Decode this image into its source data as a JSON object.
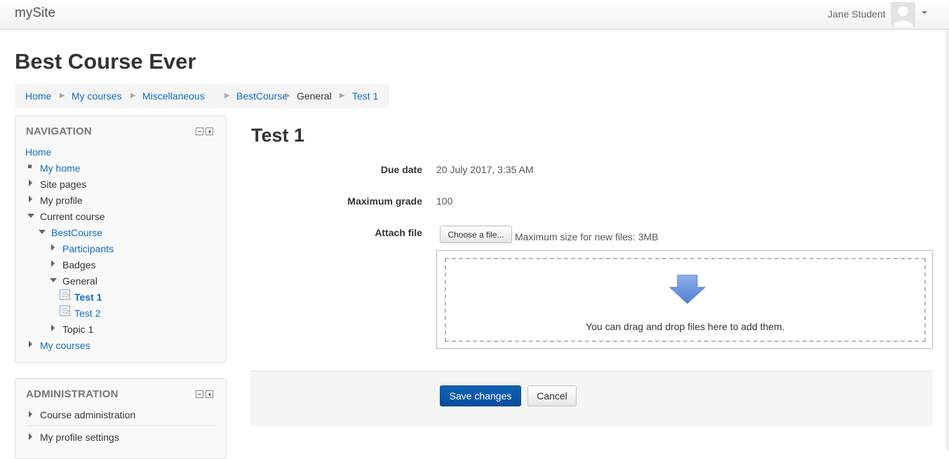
{
  "navbar": {
    "brand": "mySite",
    "user_name": "Jane Student"
  },
  "page": {
    "heading": "Best Course Ever"
  },
  "breadcrumb": [
    {
      "label": "Home",
      "link": true
    },
    {
      "label": "My courses",
      "link": true
    },
    {
      "label": "Miscellaneous",
      "link": true
    },
    {
      "label": "BestCourse",
      "link": true
    },
    {
      "label": "General",
      "link": false
    },
    {
      "label": "Test 1",
      "link": true
    }
  ],
  "navigation": {
    "title": "NAVIGATION",
    "items": [
      {
        "label": "Home",
        "type": "link",
        "icon": "none"
      },
      {
        "label": "My home",
        "type": "link",
        "icon": "bullet-square"
      },
      {
        "label": "Site pages",
        "type": "text",
        "icon": "expand-triangle"
      },
      {
        "label": "My profile",
        "type": "text",
        "icon": "expand-triangle"
      },
      {
        "label": "Current course",
        "type": "text",
        "icon": "collapse-triangle"
      },
      {
        "label": "BestCourse",
        "type": "link",
        "icon": "collapse-triangle"
      },
      {
        "label": "Participants",
        "type": "link",
        "icon": "expand-triangle"
      },
      {
        "label": "Badges",
        "type": "text",
        "icon": "expand-triangle"
      },
      {
        "label": "General",
        "type": "text",
        "icon": "collapse-triangle"
      },
      {
        "label": "Test 1",
        "type": "link-active",
        "icon": "assignment-icon"
      },
      {
        "label": "Test 2",
        "type": "link",
        "icon": "assignment-icon"
      },
      {
        "label": "Topic 1",
        "type": "text",
        "icon": "expand-triangle"
      },
      {
        "label": "My courses",
        "type": "link",
        "icon": "expand-triangle"
      }
    ]
  },
  "administration": {
    "title": "ADMINISTRATION",
    "items": [
      {
        "label": "Course administration",
        "icon": "expand-triangle"
      },
      {
        "label": "My profile settings",
        "icon": "expand-triangle"
      }
    ]
  },
  "main": {
    "title": "Test 1",
    "due_date": {
      "label": "Due date",
      "value": "20 July 2017, 3:35 AM"
    },
    "max_grade": {
      "label": "Maximum grade",
      "value": "100"
    },
    "attach": {
      "label": "Attach file",
      "choose_button": "Choose a file...",
      "max_size": "Maximum size for new files: 3MB",
      "drop_text": "You can drag and drop files here to add them."
    },
    "save_button": "Save changes",
    "cancel_button": "Cancel"
  },
  "colors": {
    "link": "#0f6cbf",
    "primary_button": "#0a4c9a",
    "dropzone_arrow": "#6f96dc"
  }
}
